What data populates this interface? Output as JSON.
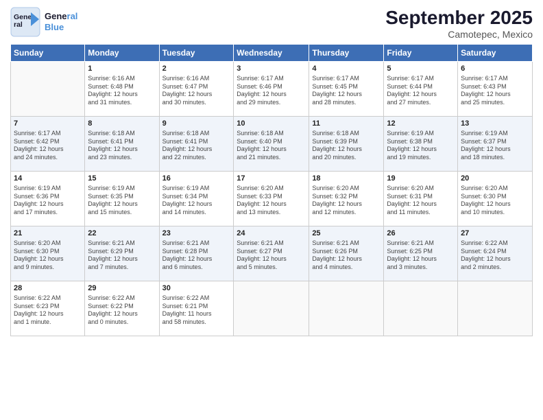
{
  "header": {
    "logo_line1": "General",
    "logo_line2": "Blue",
    "title": "September 2025",
    "subtitle": "Camotepec, Mexico"
  },
  "days_of_week": [
    "Sunday",
    "Monday",
    "Tuesday",
    "Wednesday",
    "Thursday",
    "Friday",
    "Saturday"
  ],
  "weeks": [
    [
      {
        "day": "",
        "info": ""
      },
      {
        "day": "1",
        "info": "Sunrise: 6:16 AM\nSunset: 6:48 PM\nDaylight: 12 hours\nand 31 minutes."
      },
      {
        "day": "2",
        "info": "Sunrise: 6:16 AM\nSunset: 6:47 PM\nDaylight: 12 hours\nand 30 minutes."
      },
      {
        "day": "3",
        "info": "Sunrise: 6:17 AM\nSunset: 6:46 PM\nDaylight: 12 hours\nand 29 minutes."
      },
      {
        "day": "4",
        "info": "Sunrise: 6:17 AM\nSunset: 6:45 PM\nDaylight: 12 hours\nand 28 minutes."
      },
      {
        "day": "5",
        "info": "Sunrise: 6:17 AM\nSunset: 6:44 PM\nDaylight: 12 hours\nand 27 minutes."
      },
      {
        "day": "6",
        "info": "Sunrise: 6:17 AM\nSunset: 6:43 PM\nDaylight: 12 hours\nand 25 minutes."
      }
    ],
    [
      {
        "day": "7",
        "info": "Sunrise: 6:17 AM\nSunset: 6:42 PM\nDaylight: 12 hours\nand 24 minutes."
      },
      {
        "day": "8",
        "info": "Sunrise: 6:18 AM\nSunset: 6:41 PM\nDaylight: 12 hours\nand 23 minutes."
      },
      {
        "day": "9",
        "info": "Sunrise: 6:18 AM\nSunset: 6:41 PM\nDaylight: 12 hours\nand 22 minutes."
      },
      {
        "day": "10",
        "info": "Sunrise: 6:18 AM\nSunset: 6:40 PM\nDaylight: 12 hours\nand 21 minutes."
      },
      {
        "day": "11",
        "info": "Sunrise: 6:18 AM\nSunset: 6:39 PM\nDaylight: 12 hours\nand 20 minutes."
      },
      {
        "day": "12",
        "info": "Sunrise: 6:19 AM\nSunset: 6:38 PM\nDaylight: 12 hours\nand 19 minutes."
      },
      {
        "day": "13",
        "info": "Sunrise: 6:19 AM\nSunset: 6:37 PM\nDaylight: 12 hours\nand 18 minutes."
      }
    ],
    [
      {
        "day": "14",
        "info": "Sunrise: 6:19 AM\nSunset: 6:36 PM\nDaylight: 12 hours\nand 17 minutes."
      },
      {
        "day": "15",
        "info": "Sunrise: 6:19 AM\nSunset: 6:35 PM\nDaylight: 12 hours\nand 15 minutes."
      },
      {
        "day": "16",
        "info": "Sunrise: 6:19 AM\nSunset: 6:34 PM\nDaylight: 12 hours\nand 14 minutes."
      },
      {
        "day": "17",
        "info": "Sunrise: 6:20 AM\nSunset: 6:33 PM\nDaylight: 12 hours\nand 13 minutes."
      },
      {
        "day": "18",
        "info": "Sunrise: 6:20 AM\nSunset: 6:32 PM\nDaylight: 12 hours\nand 12 minutes."
      },
      {
        "day": "19",
        "info": "Sunrise: 6:20 AM\nSunset: 6:31 PM\nDaylight: 12 hours\nand 11 minutes."
      },
      {
        "day": "20",
        "info": "Sunrise: 6:20 AM\nSunset: 6:30 PM\nDaylight: 12 hours\nand 10 minutes."
      }
    ],
    [
      {
        "day": "21",
        "info": "Sunrise: 6:20 AM\nSunset: 6:30 PM\nDaylight: 12 hours\nand 9 minutes."
      },
      {
        "day": "22",
        "info": "Sunrise: 6:21 AM\nSunset: 6:29 PM\nDaylight: 12 hours\nand 7 minutes."
      },
      {
        "day": "23",
        "info": "Sunrise: 6:21 AM\nSunset: 6:28 PM\nDaylight: 12 hours\nand 6 minutes."
      },
      {
        "day": "24",
        "info": "Sunrise: 6:21 AM\nSunset: 6:27 PM\nDaylight: 12 hours\nand 5 minutes."
      },
      {
        "day": "25",
        "info": "Sunrise: 6:21 AM\nSunset: 6:26 PM\nDaylight: 12 hours\nand 4 minutes."
      },
      {
        "day": "26",
        "info": "Sunrise: 6:21 AM\nSunset: 6:25 PM\nDaylight: 12 hours\nand 3 minutes."
      },
      {
        "day": "27",
        "info": "Sunrise: 6:22 AM\nSunset: 6:24 PM\nDaylight: 12 hours\nand 2 minutes."
      }
    ],
    [
      {
        "day": "28",
        "info": "Sunrise: 6:22 AM\nSunset: 6:23 PM\nDaylight: 12 hours\nand 1 minute."
      },
      {
        "day": "29",
        "info": "Sunrise: 6:22 AM\nSunset: 6:22 PM\nDaylight: 12 hours\nand 0 minutes."
      },
      {
        "day": "30",
        "info": "Sunrise: 6:22 AM\nSunset: 6:21 PM\nDaylight: 11 hours\nand 58 minutes."
      },
      {
        "day": "",
        "info": ""
      },
      {
        "day": "",
        "info": ""
      },
      {
        "day": "",
        "info": ""
      },
      {
        "day": "",
        "info": ""
      }
    ]
  ]
}
